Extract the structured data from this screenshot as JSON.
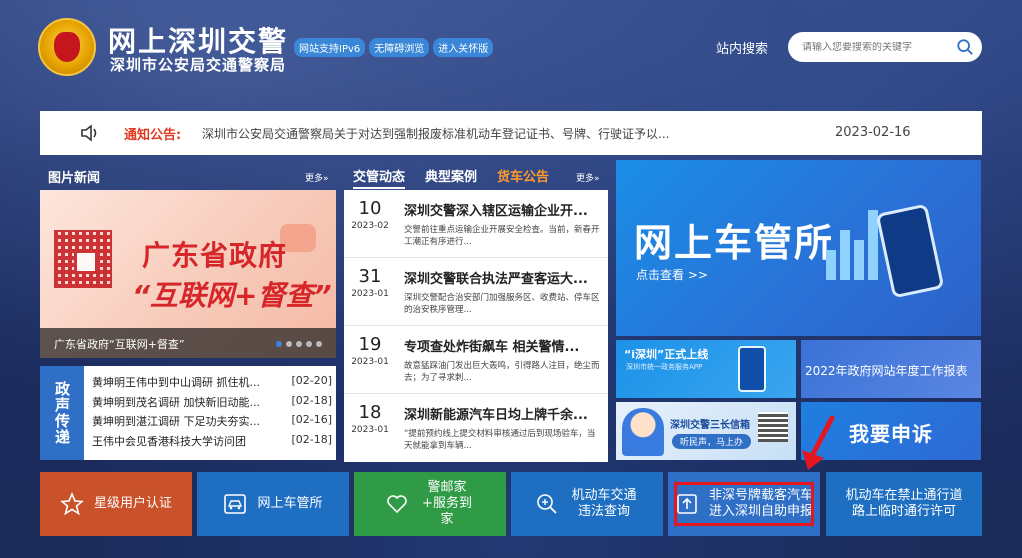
{
  "header": {
    "title": "网上深圳交警",
    "subtitle": "深圳市公安局交通警察局",
    "badges": [
      "网站支持IPv6",
      "无障碍浏览",
      "进入关怀版"
    ],
    "search_label": "站内搜索",
    "search_placeholder": "请输入您要搜索的关键字"
  },
  "notice": {
    "label": "通知公告:",
    "text": "深圳市公安局交通警察局关于对达到强制报废标准机动车登记证书、号牌、行驶证予以...",
    "date": "2023-02-16"
  },
  "picture_news": {
    "title": "图片新闻",
    "more": "更多»",
    "banner_line1": "广东省政府",
    "banner_line2": "“互联网+督查”",
    "caption": "广东省政府“互联网+督查”"
  },
  "policy": {
    "tag": "政声传递",
    "items": [
      {
        "title": "黄坤明王伟中到中山调研 抓住机...",
        "date": "[02-20]"
      },
      {
        "title": "黄坤明到茂名调研 加快新旧动能...",
        "date": "[02-18]"
      },
      {
        "title": "黄坤明到湛江调研 下足功夫夯实...",
        "date": "[02-16]"
      },
      {
        "title": "王伟中会见香港科技大学访问团",
        "date": "[02-18]"
      }
    ]
  },
  "tabs": {
    "items": [
      "交管动态",
      "典型案例",
      "货车公告"
    ],
    "more": "更多»"
  },
  "news": [
    {
      "day": "10",
      "ym": "2023-02",
      "title": "深圳交警深入辖区运输企业开...",
      "summary": "交警前往重点运输企业开展安全检查。当前，新春开工潮正有序进行..."
    },
    {
      "day": "31",
      "ym": "2023-01",
      "title": "深圳交警联合执法严查客运大...",
      "summary": "深圳交警配合治安部门加强服务区、收费站、停车区的治安秩序管理..."
    },
    {
      "day": "19",
      "ym": "2023-01",
      "title": "专项查处炸街飙车 相关警情...",
      "summary": "故意猛踩油门发出巨大轰鸣，引得路人注目，绝尘而去；为了寻求刺..."
    },
    {
      "day": "18",
      "ym": "2023-01",
      "title": "深圳新能源汽车日均上牌千余...",
      "summary": "“提前预约线上提交材料审核通过后到现场验车，当天就能拿到车辆..."
    }
  ],
  "promos": {
    "big_title": "网上车管所",
    "big_link": "点击查看 >>",
    "p1_title": "“i深圳”正式上线",
    "p1_sub": "深圳市统一政务服务APP",
    "p2_title": "2022年政府网站年度工作报表",
    "p3_title": "深圳交警三长信箱",
    "p3_pill": "听民声，马上办",
    "p4_title": "我要申诉"
  },
  "buttons": [
    {
      "label": "星级用户认证"
    },
    {
      "label": "网上车管所"
    },
    {
      "label": "警邮家+服务到家"
    },
    {
      "label": "机动车交通违法查询"
    },
    {
      "label": "非深号牌载客汽车进入深圳自助申报"
    },
    {
      "label": "机动车在禁止通行道路上临时通行许可"
    }
  ],
  "colors": {
    "notice_label": "#e03a22",
    "tab_orange": "#ff9b2b",
    "highlight_border": "#e5161d"
  }
}
